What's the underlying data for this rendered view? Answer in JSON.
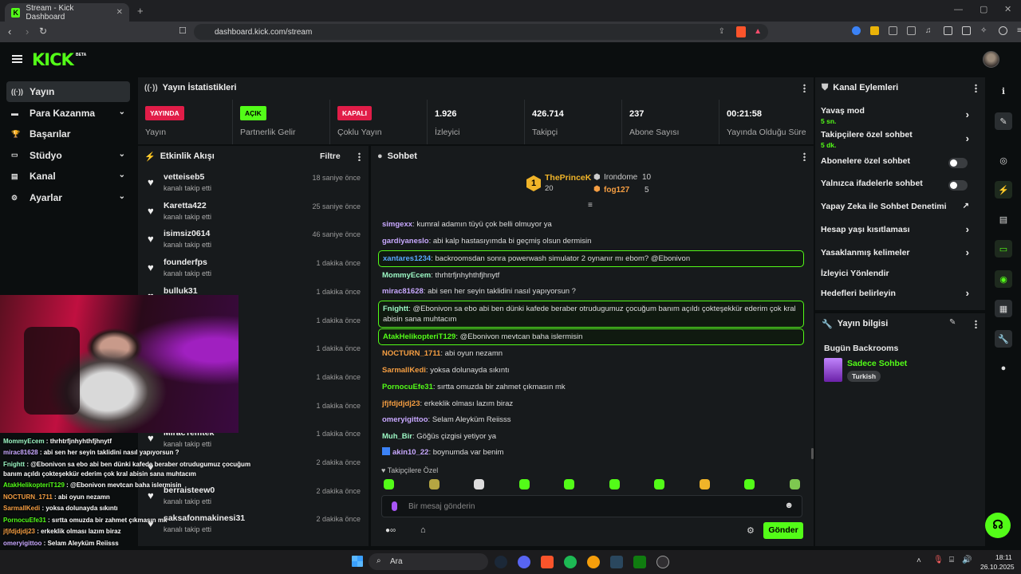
{
  "browser": {
    "tab_title": "Stream - Kick Dashboard",
    "url": "dashboard.kick.com/stream",
    "new_tab": "+"
  },
  "app": {
    "logo": "KICK",
    "beta": "BETA"
  },
  "nav": [
    {
      "label": "Yayın",
      "icon": "broadcast-icon",
      "active": true,
      "expandable": false
    },
    {
      "label": "Para Kazanma",
      "icon": "money-icon",
      "expandable": true
    },
    {
      "label": "Başarılar",
      "icon": "trophy-icon",
      "expandable": false
    },
    {
      "label": "Stüdyo",
      "icon": "studio-icon",
      "expandable": true
    },
    {
      "label": "Kanal",
      "icon": "channel-icon",
      "expandable": true
    },
    {
      "label": "Ayarlar",
      "icon": "gear-icon",
      "expandable": true
    }
  ],
  "stats": {
    "title": "Yayın İstatistikleri",
    "items": [
      {
        "badge": "YAYINDA",
        "badge_color": "#e11d48",
        "label": "Yayın"
      },
      {
        "badge": "AÇIK",
        "badge_color": "#53fc18",
        "label": "Partnerlik Gelir Programı"
      },
      {
        "badge": "KAPALI",
        "badge_color": "#e11d48",
        "label": "Çoklu Yayın"
      },
      {
        "value": "1.926",
        "label": "İzleyici"
      },
      {
        "value": "426.714",
        "label": "Takipçi"
      },
      {
        "value": "237",
        "label": "Abone Sayısı"
      },
      {
        "value": "00:21:58",
        "label": "Yayında Olduğu Süre"
      }
    ]
  },
  "activity": {
    "title": "Etkinlik Akışı",
    "filter": "Filtre",
    "items": [
      {
        "name": "vetteiseb5",
        "action": "kanalı takip etti",
        "time": "18 saniye önce"
      },
      {
        "name": "Karetta422",
        "action": "kanalı takip etti",
        "time": "25 saniye önce"
      },
      {
        "name": "isimsiz0614",
        "action": "kanalı takip etti",
        "time": "46 saniye önce"
      },
      {
        "name": "founderfps",
        "action": "kanalı takip etti",
        "time": "1 dakika önce"
      },
      {
        "name": "bulluk31",
        "action": "",
        "time": "1 dakika önce"
      },
      {
        "name": "",
        "action": "",
        "time": "1 dakika önce"
      },
      {
        "name": "",
        "action": "",
        "time": "1 dakika önce"
      },
      {
        "name": "",
        "action": "",
        "time": "1 dakika önce"
      },
      {
        "name": "",
        "action": "",
        "time": "1 dakika önce"
      },
      {
        "name": "MiracTemtek",
        "action": "kanalı takip etti",
        "time": "1 dakika önce"
      },
      {
        "name": "",
        "action": "",
        "time": "2 dakika önce"
      },
      {
        "name": "berraisteew0",
        "action": "kanalı takip etti",
        "time": "2 dakika önce"
      },
      {
        "name": "saksafonmakinesi31",
        "action": "kanalı takip etti",
        "time": "2 dakika önce"
      }
    ]
  },
  "chat": {
    "title": "Sohbet",
    "leaderboard": {
      "first": "ThePrinceK",
      "first_count": "20",
      "second": "Irondome",
      "second_count": "10",
      "third": "fog127",
      "third_count": "5"
    },
    "messages": [
      {
        "user": "simgexx",
        "color": "#c8a8ff",
        "text": "kumral adamın tüyü çok belli olmuyor ya",
        "hl": false
      },
      {
        "user": "gardiyaneslo",
        "color": "#c8a8ff",
        "text": "abi kalp hastasıyımda bi geçmiş olsun dermisin",
        "hl": false
      },
      {
        "user": "xantares1234",
        "color": "#5aa9ff",
        "text": "backroomsdan sonra powerwash simulator 2 oynanır mı ebom? @Ebonivon",
        "hl": true
      },
      {
        "user": "MommyEcem",
        "color": "#9cf7c4",
        "text": "thrhtrfjnhyhthfjhnytf",
        "hl": false
      },
      {
        "user": "mirac81628",
        "color": "#c8a8ff",
        "text": "abi sen her seyin taklidini nasıl yapıyorsun ?",
        "hl": false
      },
      {
        "user": "Fnightt",
        "color": "#9cf7c4",
        "text": "@Ebonivon sa ebo abi ben dünki kafede beraber otrudugumuz çocuğum banım açıldı çokteşekkür ederim çok kral abisin sana muhtacım",
        "hl": true
      },
      {
        "user": "AtakHelikopteriT129",
        "color": "#53fc18",
        "text": "@Ebonivon mevtcan baha islermisin",
        "hl": true
      },
      {
        "user": "NOCTURN_1711",
        "color": "#f59e42",
        "text": "abi oyun nezamn",
        "hl": false
      },
      {
        "user": "SarmallKedi",
        "color": "#f59e42",
        "text": "yoksa dolunayda sıkıntı",
        "hl": false
      },
      {
        "user": "PornocuEfe31",
        "color": "#53fc18",
        "text": "sırtta omuzda bir zahmet çıkmasın mk",
        "hl": false
      },
      {
        "user": "jfjfdjdjdj23",
        "color": "#f59e42",
        "text": "erkeklik olması lazım biraz",
        "hl": false
      },
      {
        "user": "omeryigittoo",
        "color": "#c8a8ff",
        "text": "Selam Aleyküm Reiisss",
        "hl": false
      },
      {
        "user": "Muh_Bir",
        "color": "#9cf7c4",
        "text": "Göğüs çizgisi yetiyor ya",
        "hl": false
      },
      {
        "user": "akin10_22",
        "color": "#c8a8ff",
        "text": "boynumda var benim",
        "hl": false
      }
    ],
    "followers_only": "Takipçilere Özel",
    "input_placeholder": "Bir mesaj gönderin",
    "send": "Gönder"
  },
  "channel_actions": {
    "title": "Kanal Eylemleri",
    "items": [
      {
        "label": "Yavaş mod",
        "sub": "5 sn.",
        "kind": "chev"
      },
      {
        "label": "Takipçilere özel sohbet",
        "sub": "5 dk.",
        "kind": "chev"
      },
      {
        "label": "Abonelere özel sohbet",
        "sub": "",
        "kind": "toggle"
      },
      {
        "label": "Yalnızca ifadelerle sohbet",
        "sub": "",
        "kind": "toggle"
      },
      {
        "label": "Yapay Zeka ile Sohbet Denetimi",
        "sub": "",
        "kind": "ext"
      },
      {
        "label": "Hesap yaşı kısıtlaması",
        "sub": "",
        "kind": "chev"
      },
      {
        "label": "Yasaklanmış kelimeler",
        "sub": "",
        "kind": "chev"
      },
      {
        "label": "İzleyici Yönlendir",
        "sub": "",
        "kind": "none"
      },
      {
        "label": "Hedefleri belirleyin",
        "sub": "",
        "kind": "chev"
      }
    ]
  },
  "stream_info": {
    "title": "Yayın bilgisi",
    "stream_title": "Bugün Backrooms",
    "category": "Sadece Sohbet",
    "tag": "Turkish"
  },
  "overlay_chat": [
    {
      "user": "MommyEcem",
      "color": "#9cf7c4",
      "text": "thrhtrfjnhyhthfjhnytf"
    },
    {
      "user": "mirac81628",
      "color": "#c8a8ff",
      "text": "abi sen her seyin taklidini nasıl yapıyorsun ?"
    },
    {
      "user": "Fnightt",
      "color": "#9cf7c4",
      "text": "@Ebonivon sa ebo abi ben dünki kafede beraber otrudugumuz çocuğum"
    },
    {
      "user": "",
      "color": "#fff",
      "text": "banım açıldı çokteşekkür ederim çok kral abisin sana muhtacım"
    },
    {
      "user": "AtakHelikopteriT129",
      "color": "#53fc18",
      "text": "@Ebonivon mevtcan baha islermisin"
    },
    {
      "user": "NOCTURN_1711",
      "color": "#f59e42",
      "text": "abi oyun nezamn"
    },
    {
      "user": "SarmallKedi",
      "color": "#f59e42",
      "text": "yoksa dolunayda sıkıntı"
    },
    {
      "user": "PornocuEfe31",
      "color": "#53fc18",
      "text": "sırtta omuzda bir zahmet çıkmasın mk"
    },
    {
      "user": "jfjfdjdjdj23",
      "color": "#f59e42",
      "text": "erkeklik olması lazım biraz"
    },
    {
      "user": "omeryigittoo",
      "color": "#c8a8ff",
      "text": "Selam Aleyküm Reiisss"
    },
    {
      "user": "Muh_Bir",
      "color": "#9cf7c4",
      "text": "Göğüs çizgisi yetiyor ya"
    },
    {
      "user": "2",
      "color": "#fff",
      "text": "boynumda var benim"
    }
  ],
  "taskbar": {
    "search": "Ara",
    "time": "18:11",
    "date": "26.10.2025"
  },
  "colors": {
    "accent": "#53fc18",
    "live": "#e11d48"
  }
}
